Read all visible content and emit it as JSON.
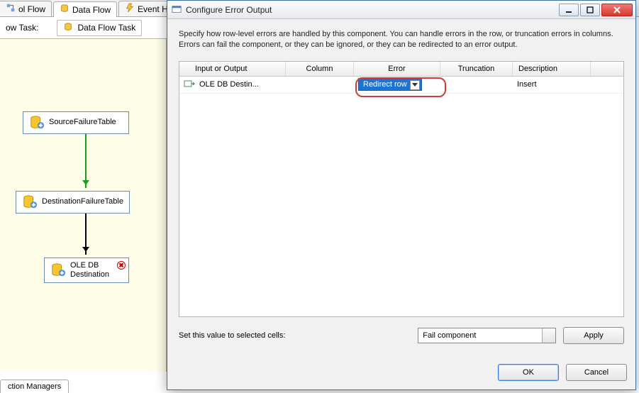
{
  "tabs": {
    "control_flow": "ol Flow",
    "data_flow": "Data Flow",
    "event_handlers": "Event Handlers"
  },
  "breadcrumb": {
    "label": "ow Task:",
    "task_name": "Data Flow Task"
  },
  "canvas_nodes": {
    "source": "SourceFailureTable",
    "dest": "DestinationFailureTable",
    "oledb": "OLE DB\nDestination"
  },
  "bottom_tab": "ction Managers",
  "dialog": {
    "title": "Configure Error Output",
    "description": "Specify how row-level errors are handled by this component. You can handle errors in the row, or truncation errors in columns. Errors can fail the component, or they can be ignored, or they can be redirected to an error output.",
    "headers": {
      "c1": "Input or Output",
      "c2": "Column",
      "c3": "Error",
      "c4": "Truncation",
      "c5": "Description"
    },
    "row": {
      "name": "OLE DB Destin...",
      "error": "Redirect row",
      "description": "Insert"
    },
    "set_label": "Set this value to selected cells:",
    "combo_value": "Fail component",
    "apply": "Apply",
    "ok": "OK",
    "cancel": "Cancel"
  }
}
